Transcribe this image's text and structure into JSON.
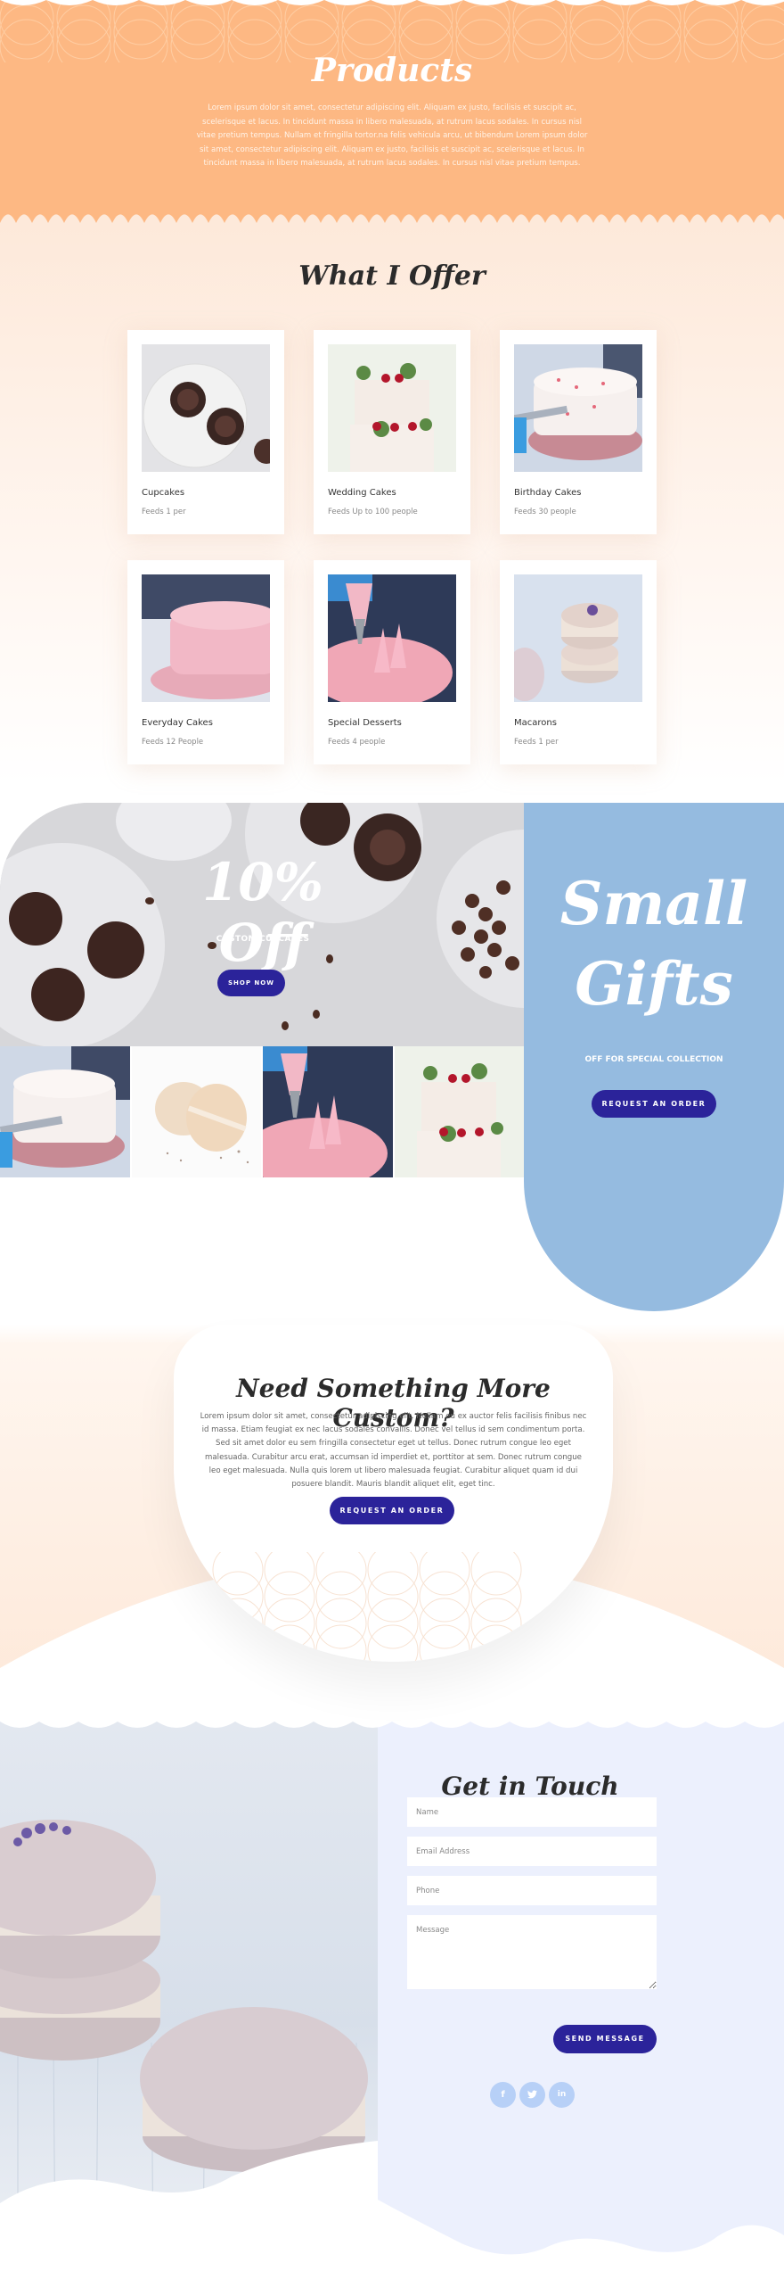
{
  "colors": {
    "hero_bg": "#fdb883",
    "button": "#2b239a",
    "gift_bg": "#95bbe0",
    "contact_bg": "#ecf0fd",
    "social": "#b7d0f7"
  },
  "hero": {
    "title": "Products",
    "text": "Lorem ipsum dolor sit amet, consectetur adipiscing elit. Aliquam ex justo, facilisis et suscipit ac, scelerisque et lacus. In tincidunt massa in libero malesuada, at rutrum lacus sodales. In cursus nisl vitae pretium tempus. Nullam et fringilla tortor.na felis vehicula arcu, ut bibendum Lorem ipsum dolor sit amet, consectetur adipiscing elit. Aliquam ex justo, facilisis et suscipit ac, scelerisque et lacus. In tincidunt massa in libero malesuada, at rutrum lacus sodales. In cursus nisl vitae pretium tempus."
  },
  "offer": {
    "title": "What I Offer",
    "products": [
      {
        "name": "Cupcakes",
        "feeds": "Feeds 1 per",
        "image": "cupcakes-photo"
      },
      {
        "name": "Wedding Cakes",
        "feeds": "Feeds Up to 100 people",
        "image": "wedding-cake-photo"
      },
      {
        "name": "Birthday Cakes",
        "feeds": "Feeds 30 people",
        "image": "birthday-cake-photo"
      },
      {
        "name": "Everyday Cakes",
        "feeds": "Feeds 12 People",
        "image": "pink-cake-photo"
      },
      {
        "name": "Special Desserts",
        "feeds": "Feeds 4 people",
        "image": "piping-photo"
      },
      {
        "name": "Macarons",
        "feeds": "Feeds 1 per",
        "image": "macarons-photo"
      }
    ]
  },
  "promo": {
    "title": "10% Off",
    "subtitle": "CUSTOM CUPCAKES",
    "button": "SHOP NOW",
    "thumbnails": [
      "birthday-cake-photo",
      "macarons-photo",
      "piping-photo",
      "wedding-cake-photo"
    ]
  },
  "gift": {
    "title_line1": "Small",
    "title_line2": "Gifts",
    "subtitle": "OFF FOR SPECIAL COLLECTION",
    "button": "REQUEST AN ORDER"
  },
  "custom": {
    "title": "Need Something More Custom?",
    "text": "Lorem ipsum dolor sit amet, consectetur adipiscing elit. Nullam eu ex auctor felis facilisis finibus nec id massa. Etiam feugiat ex nec lacus sodales convallis. Donec vel tellus id sem condimentum porta. Sed sit amet dolor eu sem fringilla consectetur eget ut tellus. Donec rutrum congue leo eget malesuada. Curabitur arcu erat, accumsan id imperdiet et, porttitor at sem. Donec rutrum congue leo eget malesuada. Nulla quis lorem ut libero malesuada feugiat. Curabitur aliquet quam id dui posuere blandit. Mauris blandit aliquet elit, eget tinc.",
    "button": "REQUEST AN ORDER"
  },
  "contact": {
    "title": "Get in Touch",
    "fields": {
      "name_placeholder": "Name",
      "email_placeholder": "Email Address",
      "phone_placeholder": "Phone",
      "message_placeholder": "Message"
    },
    "button": "SEND MESSAGE",
    "social": [
      {
        "name": "facebook",
        "glyph": "f"
      },
      {
        "name": "twitter",
        "glyph": "t"
      },
      {
        "name": "linkedin",
        "glyph": "in"
      }
    ]
  }
}
